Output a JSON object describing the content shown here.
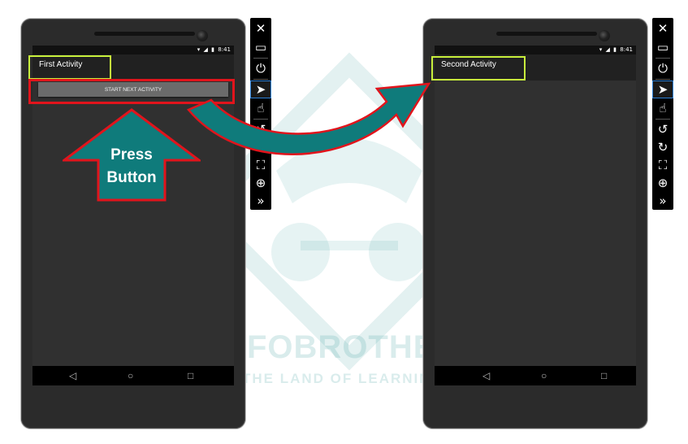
{
  "left_phone": {
    "status_time": "8:41",
    "activity_title": "First Activity",
    "button_label": "START NEXT ACTIVITY"
  },
  "right_phone": {
    "status_time": "8:41",
    "activity_title": "Second Activity"
  },
  "annotation": {
    "line1": "Press",
    "line2": "Button"
  },
  "nav_icons": [
    "back-icon",
    "home-icon",
    "recents-icon"
  ],
  "toolbar_icons": [
    "close-icon",
    "minimize-icon",
    "power-icon",
    "pointer-icon",
    "touch-icon",
    "rotate-left-icon",
    "rotate-right-icon",
    "fit-screen-icon",
    "zoom-icon",
    "more-icon"
  ],
  "watermark": {
    "brand": "INFOBROTHER",
    "tagline": "THE LAND OF LEARNING"
  },
  "colors": {
    "highlight_green": "#c8f03c",
    "highlight_red": "#e1141c",
    "arrow_teal": "#0f7b7b",
    "phone_body": "#2b2b2b",
    "screen_bg": "#303030"
  }
}
